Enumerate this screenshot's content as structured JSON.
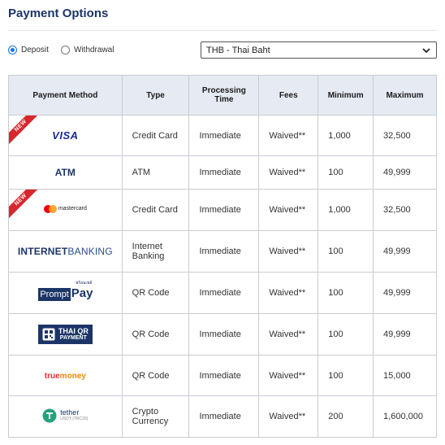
{
  "header": {
    "title": "Payment Options"
  },
  "controls": {
    "deposit_label": "Deposit",
    "withdrawal_label": "Withdrawal",
    "selected_mode": "Deposit",
    "currency": "THB - Thai Baht"
  },
  "table": {
    "headers": {
      "method": "Payment Method",
      "type": "Type",
      "processing": "Processing Time",
      "fees": "Fees",
      "minimum": "Minimum",
      "maximum": "Maximum"
    },
    "rows": [
      {
        "logo": "VISA",
        "new_badge": "NEW",
        "type": "Credit Card",
        "processing": "Immediate",
        "fees": "Waived**",
        "minimum": "1,000",
        "maximum": "32,500"
      },
      {
        "logo": "ATM",
        "type": "ATM",
        "processing": "Immediate",
        "fees": "Waived**",
        "minimum": "100",
        "maximum": "49,999"
      },
      {
        "logo": "mastercard",
        "new_badge": "NEW",
        "type": "Credit Card",
        "processing": "Immediate",
        "fees": "Waived**",
        "minimum": "1,000",
        "maximum": "32,500"
      },
      {
        "logo_a": "INTERNET",
        "logo_b": "BANKING",
        "type": "Internet Banking",
        "processing": "Immediate",
        "fees": "Waived**",
        "minimum": "100",
        "maximum": "49,999"
      },
      {
        "logo_a": "พร้อมเพย์",
        "logo_b": "Prompt",
        "logo_c": "Pay",
        "type": "QR Code",
        "processing": "Immediate",
        "fees": "Waived**",
        "minimum": "100",
        "maximum": "49,999"
      },
      {
        "logo_a": "THAI QR",
        "logo_b": "PAYMENT",
        "type": "QR Code",
        "processing": "Immediate",
        "fees": "Waived**",
        "minimum": "100",
        "maximum": "49,999"
      },
      {
        "logo_a": "true",
        "logo_b": "money",
        "type": "QR Code",
        "processing": "Immediate",
        "fees": "Waived**",
        "minimum": "100",
        "maximum": "15,000"
      },
      {
        "logo_a": "tether",
        "logo_b": "USDT (TRC20)",
        "type": "Crypto Currency",
        "processing": "Immediate",
        "fees": "Waived**",
        "minimum": "200",
        "maximum": "1,600,000"
      }
    ]
  },
  "colors": {
    "title": "#1c3567",
    "header_bg": "#e6ebf3",
    "new_ribbon": "#d7262d",
    "radio_accent": "#1a73e8"
  }
}
